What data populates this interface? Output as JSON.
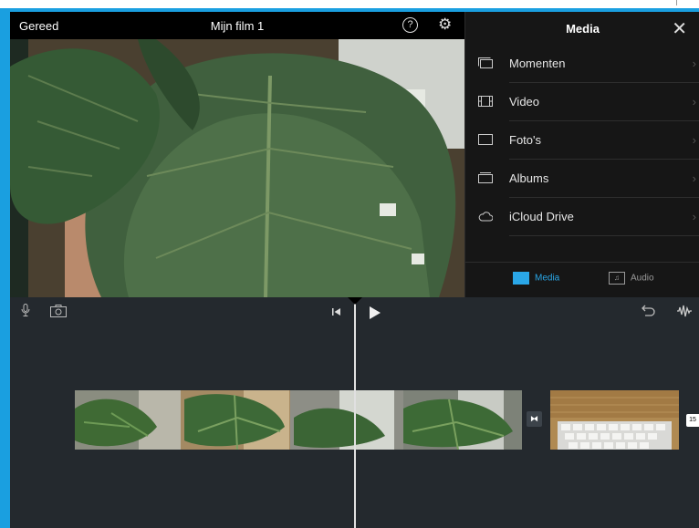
{
  "preview": {
    "done_label": "Gereed",
    "title": "Mijn film 1",
    "help_label": "?"
  },
  "media_panel": {
    "title": "Media",
    "close_glyph": "✕",
    "items": [
      {
        "label": "Momenten",
        "icon": "moments-icon"
      },
      {
        "label": "Video",
        "icon": "film-icon"
      },
      {
        "label": "Foto's",
        "icon": "photo-icon"
      },
      {
        "label": "Albums",
        "icon": "albums-icon"
      },
      {
        "label": "iCloud Drive",
        "icon": "cloud-icon"
      }
    ],
    "chevron": "›",
    "tabs": {
      "media": "Media",
      "audio": "Audio"
    }
  },
  "timeline": {
    "clip2_duration_badge": "15"
  },
  "colors": {
    "accent": "#1a9fe0",
    "active_tab": "#2aa7e8",
    "timeline_bg": "#24292e"
  }
}
